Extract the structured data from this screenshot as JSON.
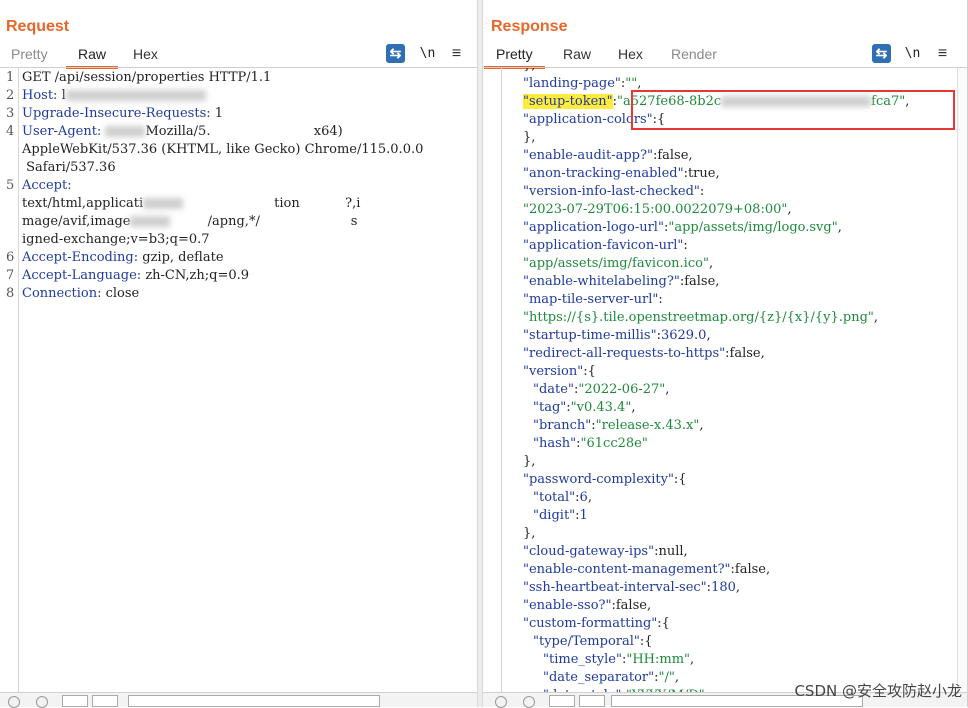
{
  "request": {
    "title": "Request",
    "tabs": [
      "Pretty",
      "Raw",
      "Hex"
    ],
    "active_tab": "Raw",
    "toolbar": {
      "wrap_icon": "wrap-icon",
      "newline_label": "\\n",
      "menu_icon": "hamburger-icon"
    },
    "lines": [
      {
        "n": "1",
        "parts": [
          {
            "t": "GET /api/session/pro",
            "c": "v"
          },
          {
            "t": "perties HTTP/1.1",
            "c": "v"
          }
        ]
      },
      {
        "n": "2",
        "parts": [
          {
            "t": "Host: ",
            "c": "k"
          },
          {
            "t": "l",
            "c": "v"
          }
        ]
      },
      {
        "n": "3",
        "parts": [
          {
            "t": "Upgrade-Insecure-Requests: ",
            "c": "k"
          },
          {
            "t": "1",
            "c": "v"
          }
        ]
      },
      {
        "n": "4",
        "parts": [
          {
            "t": "User-Agent: ",
            "c": "k"
          },
          {
            "t": "Mozilla/5.",
            "c": "v"
          },
          {
            "t": "                         x64)",
            "c": "v"
          }
        ]
      },
      {
        "n": "",
        "parts": [
          {
            "t": "AppleWebKit/537.36 (KHTML, like Gecko) Chrome/115.0.0.0",
            "c": "v"
          }
        ]
      },
      {
        "n": "",
        "parts": [
          {
            "t": " Safari/537.36",
            "c": "v"
          }
        ]
      },
      {
        "n": "5",
        "parts": [
          {
            "t": "Accept:",
            "c": "k"
          }
        ]
      },
      {
        "n": "",
        "parts": [
          {
            "t": "text/html,applicati",
            "c": "v"
          },
          {
            "t": "                      tion           ?,i",
            "c": "v"
          }
        ]
      },
      {
        "n": "",
        "parts": [
          {
            "t": "mage/avif,image",
            "c": "v"
          },
          {
            "t": "         /apng,*/",
            "c": "v"
          },
          {
            "t": "                      s",
            "c": "v"
          }
        ]
      },
      {
        "n": "",
        "parts": [
          {
            "t": "igned-exchange;v=b3;q=0.7",
            "c": "v"
          }
        ]
      },
      {
        "n": "6",
        "parts": [
          {
            "t": "Accept-Encoding: ",
            "c": "k"
          },
          {
            "t": "gzip, deflate",
            "c": "v"
          }
        ]
      },
      {
        "n": "7",
        "parts": [
          {
            "t": "Accept-Language: ",
            "c": "k"
          },
          {
            "t": "zh-CN,zh;q=0.9",
            "c": "v"
          }
        ]
      },
      {
        "n": "8",
        "parts": [
          {
            "t": "Connection: ",
            "c": "k"
          },
          {
            "t": "close",
            "c": "v"
          }
        ]
      }
    ]
  },
  "response": {
    "title": "Response",
    "tabs": [
      "Pretty",
      "Raw",
      "Hex",
      "Render"
    ],
    "active_tab": "Pretty",
    "toolbar": {
      "wrap_icon": "wrap-icon",
      "newline_label": "\\n",
      "menu_icon": "hamburger-icon"
    },
    "lines": [
      {
        "i": 0,
        "parts": [
          {
            "t": "},",
            "c": "v"
          }
        ]
      },
      {
        "i": 0,
        "parts": [
          {
            "t": "\"landing-page\"",
            "c": "k"
          },
          {
            "t": ":",
            "c": "v"
          },
          {
            "t": "\"\"",
            "c": "s"
          },
          {
            "t": ",",
            "c": "v"
          }
        ]
      },
      {
        "i": 0,
        "parts": [
          {
            "t": "\"setup-token\"",
            "c": "k",
            "hl": true
          },
          {
            "t": ":",
            "c": "v"
          },
          {
            "t": "\"a527fe68-8b2c",
            "c": "s"
          },
          {
            "t": "fca7\"",
            "c": "s",
            "gap": true
          },
          {
            "t": ",",
            "c": "v"
          }
        ]
      },
      {
        "i": 0,
        "parts": [
          {
            "t": "\"application-colors\"",
            "c": "k"
          },
          {
            "t": ":{",
            "c": "v"
          }
        ]
      },
      {
        "i": 0,
        "parts": [
          {
            "t": "},",
            "c": "v"
          }
        ]
      },
      {
        "i": 0,
        "parts": [
          {
            "t": "\"enable-audit-app?\"",
            "c": "k"
          },
          {
            "t": ":false,",
            "c": "v"
          }
        ]
      },
      {
        "i": 0,
        "parts": [
          {
            "t": "\"anon-tracking-enabled\"",
            "c": "k"
          },
          {
            "t": ":true,",
            "c": "v"
          }
        ]
      },
      {
        "i": 0,
        "parts": [
          {
            "t": "\"version-info-last-checked\"",
            "c": "k"
          },
          {
            "t": ":",
            "c": "v"
          }
        ]
      },
      {
        "i": 0,
        "parts": [
          {
            "t": "\"2023-07-29T06:15:00.0022079+08:00\"",
            "c": "s"
          },
          {
            "t": ",",
            "c": "v"
          }
        ]
      },
      {
        "i": 0,
        "parts": [
          {
            "t": "\"application-logo-url\"",
            "c": "k"
          },
          {
            "t": ":",
            "c": "v"
          },
          {
            "t": "\"app/assets/img/logo.svg\"",
            "c": "s"
          },
          {
            "t": ",",
            "c": "v"
          }
        ]
      },
      {
        "i": 0,
        "parts": [
          {
            "t": "\"application-favicon-url\"",
            "c": "k"
          },
          {
            "t": ":",
            "c": "v"
          }
        ]
      },
      {
        "i": 0,
        "parts": [
          {
            "t": "\"app/assets/img/favicon.ico\"",
            "c": "s"
          },
          {
            "t": ",",
            "c": "v"
          }
        ]
      },
      {
        "i": 0,
        "parts": [
          {
            "t": "\"enable-whitelabeling?\"",
            "c": "k"
          },
          {
            "t": ":false,",
            "c": "v"
          }
        ]
      },
      {
        "i": 0,
        "parts": [
          {
            "t": "\"map-tile-server-url\"",
            "c": "k"
          },
          {
            "t": ":",
            "c": "v"
          }
        ]
      },
      {
        "i": 0,
        "parts": [
          {
            "t": "\"https://{s}.tile.openstreetmap.org/{z}/{x}/{y}.png\"",
            "c": "s"
          },
          {
            "t": ",",
            "c": "v"
          }
        ]
      },
      {
        "i": 0,
        "parts": [
          {
            "t": "\"startup-time-millis\"",
            "c": "k"
          },
          {
            "t": ":",
            "c": "v"
          },
          {
            "t": "3629.0",
            "c": "n"
          },
          {
            "t": ",",
            "c": "v"
          }
        ]
      },
      {
        "i": 0,
        "parts": [
          {
            "t": "\"redirect-all-requests-to-https\"",
            "c": "k"
          },
          {
            "t": ":false,",
            "c": "v"
          }
        ]
      },
      {
        "i": 0,
        "parts": [
          {
            "t": "\"version\"",
            "c": "k"
          },
          {
            "t": ":{",
            "c": "v"
          }
        ]
      },
      {
        "i": 1,
        "parts": [
          {
            "t": "\"date\"",
            "c": "k"
          },
          {
            "t": ":",
            "c": "v"
          },
          {
            "t": "\"2022-06-27\"",
            "c": "s"
          },
          {
            "t": ",",
            "c": "v"
          }
        ]
      },
      {
        "i": 1,
        "parts": [
          {
            "t": "\"tag\"",
            "c": "k"
          },
          {
            "t": ":",
            "c": "v"
          },
          {
            "t": "\"v0.43.4\"",
            "c": "s"
          },
          {
            "t": ",",
            "c": "v"
          }
        ]
      },
      {
        "i": 1,
        "parts": [
          {
            "t": "\"branch\"",
            "c": "k"
          },
          {
            "t": ":",
            "c": "v"
          },
          {
            "t": "\"release-x.43.x\"",
            "c": "s"
          },
          {
            "t": ",",
            "c": "v"
          }
        ]
      },
      {
        "i": 1,
        "parts": [
          {
            "t": "\"hash\"",
            "c": "k"
          },
          {
            "t": ":",
            "c": "v"
          },
          {
            "t": "\"61cc28e\"",
            "c": "s"
          }
        ]
      },
      {
        "i": 0,
        "parts": [
          {
            "t": "},",
            "c": "v"
          }
        ]
      },
      {
        "i": 0,
        "parts": [
          {
            "t": "\"password-complexity\"",
            "c": "k"
          },
          {
            "t": ":{",
            "c": "v"
          }
        ]
      },
      {
        "i": 1,
        "parts": [
          {
            "t": "\"total\"",
            "c": "k"
          },
          {
            "t": ":",
            "c": "v"
          },
          {
            "t": "6",
            "c": "n"
          },
          {
            "t": ",",
            "c": "v"
          }
        ]
      },
      {
        "i": 1,
        "parts": [
          {
            "t": "\"digit\"",
            "c": "k"
          },
          {
            "t": ":",
            "c": "v"
          },
          {
            "t": "1",
            "c": "n"
          }
        ]
      },
      {
        "i": 0,
        "parts": [
          {
            "t": "},",
            "c": "v"
          }
        ]
      },
      {
        "i": 0,
        "parts": [
          {
            "t": "\"cloud-gateway-ips\"",
            "c": "k"
          },
          {
            "t": ":null,",
            "c": "v"
          }
        ]
      },
      {
        "i": 0,
        "parts": [
          {
            "t": "\"enable-content-management?\"",
            "c": "k"
          },
          {
            "t": ":false,",
            "c": "v"
          }
        ]
      },
      {
        "i": 0,
        "parts": [
          {
            "t": "\"ssh-heartbeat-interval-sec\"",
            "c": "k"
          },
          {
            "t": ":",
            "c": "v"
          },
          {
            "t": "180",
            "c": "n"
          },
          {
            "t": ",",
            "c": "v"
          }
        ]
      },
      {
        "i": 0,
        "parts": [
          {
            "t": "\"enable-sso?\"",
            "c": "k"
          },
          {
            "t": ":false,",
            "c": "v"
          }
        ]
      },
      {
        "i": 0,
        "parts": [
          {
            "t": "\"custom-formatting\"",
            "c": "k"
          },
          {
            "t": ":{",
            "c": "v"
          }
        ]
      },
      {
        "i": 1,
        "parts": [
          {
            "t": "\"type/Temporal\"",
            "c": "k"
          },
          {
            "t": ":{",
            "c": "v"
          }
        ]
      },
      {
        "i": 2,
        "parts": [
          {
            "t": "\"time_style\"",
            "c": "k"
          },
          {
            "t": ":",
            "c": "v"
          },
          {
            "t": "\"HH:mm\"",
            "c": "s"
          },
          {
            "t": ",",
            "c": "v"
          }
        ]
      },
      {
        "i": 2,
        "parts": [
          {
            "t": "\"date_separator\"",
            "c": "k"
          },
          {
            "t": ":",
            "c": "v"
          },
          {
            "t": "\"/\"",
            "c": "s"
          },
          {
            "t": ",",
            "c": "v"
          }
        ]
      },
      {
        "i": 2,
        "parts": [
          {
            "t": "\"date_style\"",
            "c": "k"
          },
          {
            "t": ":",
            "c": "v"
          },
          {
            "t": "\"YYYY/M/D\"",
            "c": "s"
          }
        ]
      }
    ]
  },
  "layout_switch": [
    "split-horizontal-icon",
    "split-vertical-icon",
    "single-pane-icon"
  ],
  "watermark": "CSDN @安全攻防赵小龙",
  "colors": {
    "accent": "#e8672a",
    "key": "#1f3a9e",
    "string": "#1d8a3b",
    "highlight": "#ffeb3b",
    "box": "#e53935"
  }
}
